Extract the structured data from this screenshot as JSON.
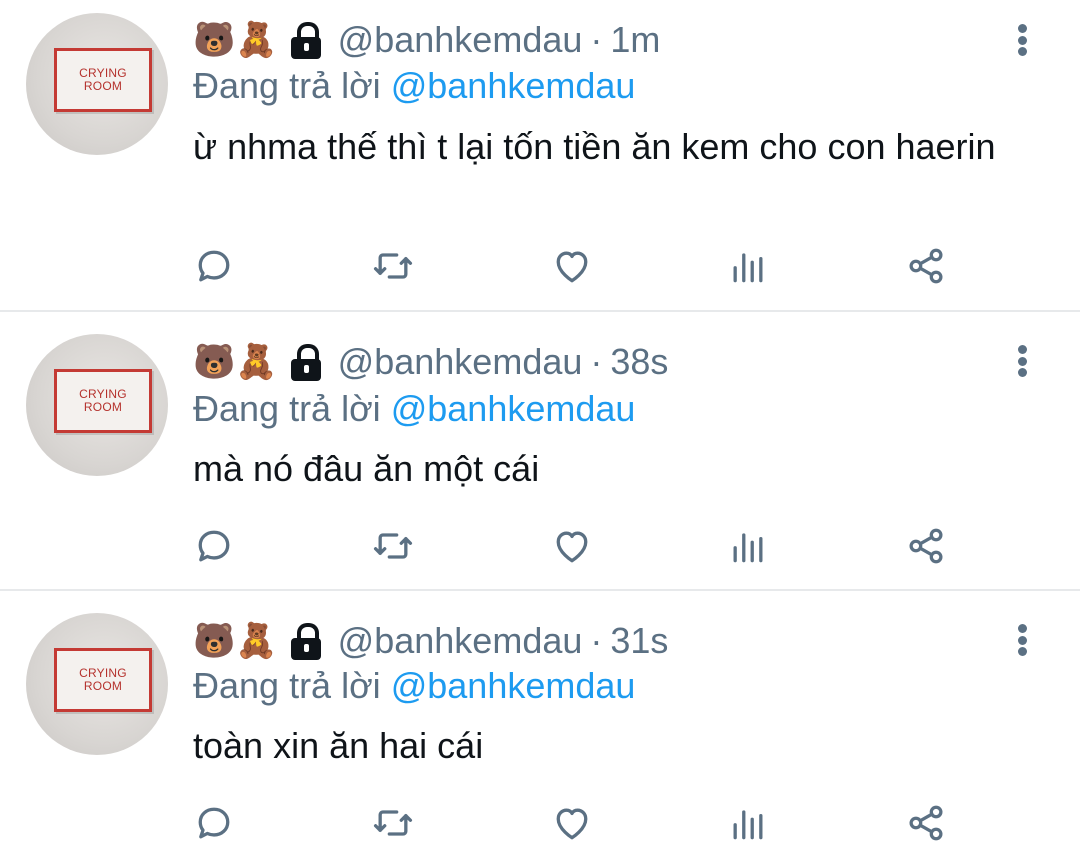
{
  "tweets": [
    {
      "avatar_text_line1": "CRYING",
      "avatar_text_line2": "ROOM",
      "emojis": "🐻🧸",
      "handle": "@banhkemdau",
      "time": "1m",
      "replying_prefix": "Đang trả lời",
      "replying_to": "@banhkemdau",
      "text": "ừ nhma thế thì t lại tốn tiền ăn kem cho con haerin"
    },
    {
      "avatar_text_line1": "CRYING",
      "avatar_text_line2": "ROOM",
      "emojis": "🐻🧸",
      "handle": "@banhkemdau",
      "time": "38s",
      "replying_prefix": "Đang trả lời",
      "replying_to": "@banhkemdau",
      "text": "mà nó đâu ăn một cái"
    },
    {
      "avatar_text_line1": "CRYING",
      "avatar_text_line2": "ROOM",
      "emojis": "🐻🧸",
      "handle": "@banhkemdau",
      "time": "31s",
      "replying_prefix": "Đang trả lời",
      "replying_to": "@banhkemdau",
      "text": "toàn xin ăn hai cái"
    }
  ],
  "separator": "·",
  "icons": {
    "lock": "lock-icon",
    "more": "more-vertical-icon",
    "reply": "reply-icon",
    "retweet": "retweet-icon",
    "like": "heart-icon",
    "stats": "stats-icon",
    "share": "share-icon"
  },
  "colors": {
    "text": "#0f1419",
    "secondary": "#5b7083",
    "mention": "#1d9bf0",
    "divider": "#e7e9eb"
  }
}
